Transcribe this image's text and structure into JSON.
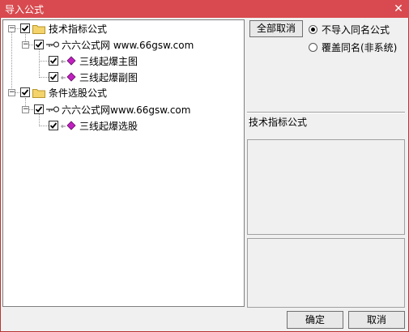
{
  "window": {
    "title": "导入公式",
    "close_glyph": "✕"
  },
  "tree": {
    "nodes": [
      {
        "label": "技术指标公式",
        "expander": "−",
        "checked": true,
        "icon": "folder-icon"
      },
      {
        "label": "六六公式网 www.66gsw.com",
        "expander": "−",
        "checked": true,
        "icon": "key-icon"
      },
      {
        "label": "三线起爆主图",
        "checked": true,
        "icon": "formula-gem-icon"
      },
      {
        "label": "三线起爆副图",
        "checked": true,
        "icon": "formula-gem-icon"
      },
      {
        "label": "条件选股公式",
        "expander": "−",
        "checked": true,
        "icon": "folder-icon"
      },
      {
        "label": "六六公式网www.66gsw.com",
        "expander": "−",
        "checked": true,
        "icon": "key-icon"
      },
      {
        "label": "三线起爆选股",
        "checked": true,
        "icon": "formula-gem-icon"
      }
    ]
  },
  "options": {
    "deselect_all": "全部取消",
    "radio_no_import": "不导入同名公式",
    "radio_overwrite": "覆盖同名(非系统)",
    "selected": "no_import"
  },
  "detail": {
    "section_label": "技术指标公式"
  },
  "footer": {
    "ok": "确定",
    "cancel": "取消"
  },
  "colors": {
    "titlebar": "#d84a4f",
    "folder": "#f5d36b",
    "gem": "#c020c0"
  }
}
